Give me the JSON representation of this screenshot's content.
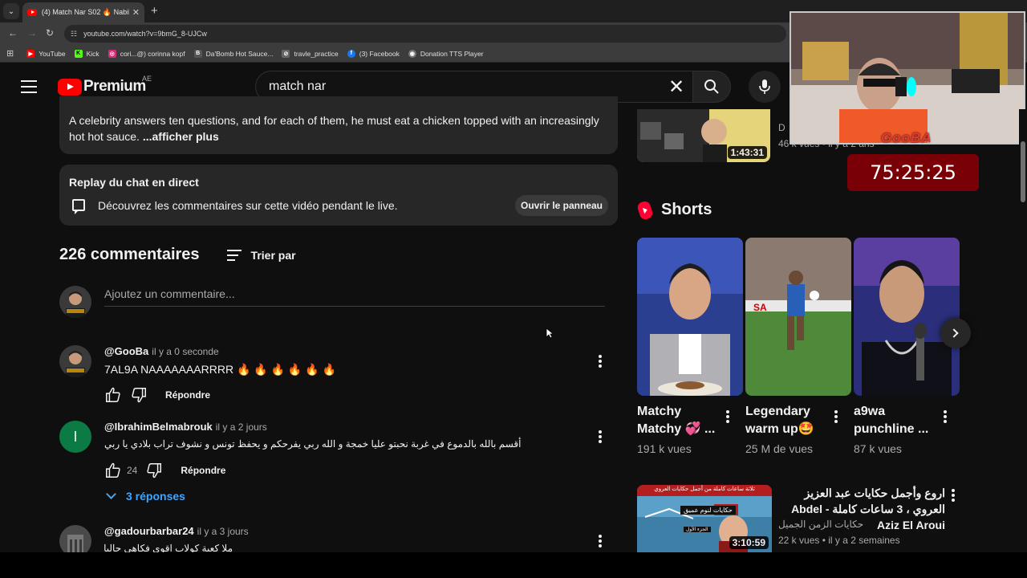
{
  "browser": {
    "tab_title": "(4) Match Nar S02 🔥 Nabil Ko",
    "url": "youtube.com/watch?v=9bmG_8-UJCw",
    "bookmarks": [
      {
        "label": "YouTube",
        "color": "#ff0000",
        "glyph": "▶"
      },
      {
        "label": "Kick",
        "color": "#53fc18",
        "glyph": "K"
      },
      {
        "label": "cori...@) corinna kopf",
        "color": "#d62976",
        "glyph": "◎"
      },
      {
        "label": "Da'Bomb Hot Sauce...",
        "color": "#555555",
        "glyph": "B"
      },
      {
        "label": "travle_practice",
        "color": "#666666",
        "glyph": "⊘"
      },
      {
        "label": "(3) Facebook",
        "color": "#1877f2",
        "glyph": "f"
      },
      {
        "label": "Donation TTS Player",
        "color": "#777777",
        "glyph": "◉"
      }
    ]
  },
  "masthead": {
    "logo_text": "Premium",
    "region": "AE",
    "search_value": "match nar"
  },
  "description": {
    "text": "A celebrity answers ten questions, and for each of them, he must eat a chicken topped with an increasingly hot hot sauce.",
    "more": "...afficher plus"
  },
  "replay": {
    "title": "Replay du chat en direct",
    "text": "Découvrez les commentaires sur cette vidéo pendant le live.",
    "button": "Ouvrir le panneau"
  },
  "comments": {
    "count_label": "226 commentaires",
    "sort_label": "Trier par",
    "add_placeholder": "Ajoutez un commentaire...",
    "items": [
      {
        "author": "@GooBa",
        "time": "il y a 0 seconde",
        "text": "7AL9A NAAAAAAARRRR 🔥 🔥 🔥 🔥 🔥 🔥",
        "likes": "",
        "reply": "Répondre",
        "avatar_color": "#2a2a2a"
      },
      {
        "author": "@IbrahimBelmabrouk",
        "time": "il y a 2 jours",
        "text": "أقسم بالله بالدموع في غربة نحبتو عليا خمجة و الله ربي يفرحكم و يحفظ تونس و نشوف تراب بلادي يا ربي",
        "likes": "24",
        "reply": "Répondre",
        "avatar_letter": "I",
        "avatar_color": "#0b7a45",
        "replies": "3 réponses"
      },
      {
        "author": "@gadourbarbar24",
        "time": "il y a 3 jours",
        "text": "ملا كعبة كولاب اقوى فكاهي حاليا",
        "avatar_color": "#555555"
      }
    ]
  },
  "sidebar": {
    "top_video": {
      "duration": "1:43:31",
      "meta_channel": "D",
      "meta": "46 k vues • il y a 2 ans"
    },
    "shorts_title": "Shorts",
    "shorts": [
      {
        "title": "Matchy Matchy 💞 ...",
        "views": "191 k vues"
      },
      {
        "title": "Legendary warm up🤩",
        "views": "25 M de vues"
      },
      {
        "title": "a9wa punchline ...",
        "views": "87 k vues"
      }
    ],
    "video2": {
      "title": "اروع وأجمل حكايات عبد العزيز العروي ، 3 ساعات كاملة - Abdel Aziz El Aroui",
      "channel": "حكايات الزمن الجميل",
      "meta": "22 k vues • il y a 2 semaines",
      "duration": "3:10:59",
      "banner": "ثلاثة ساعات كاملة من أجمل حكايات العروي",
      "caption": "حكايات لنوم عميق",
      "part": "الجزء الأول"
    }
  },
  "overlay": {
    "streamer_tag": "GooBA",
    "timer": "75:25:25"
  }
}
